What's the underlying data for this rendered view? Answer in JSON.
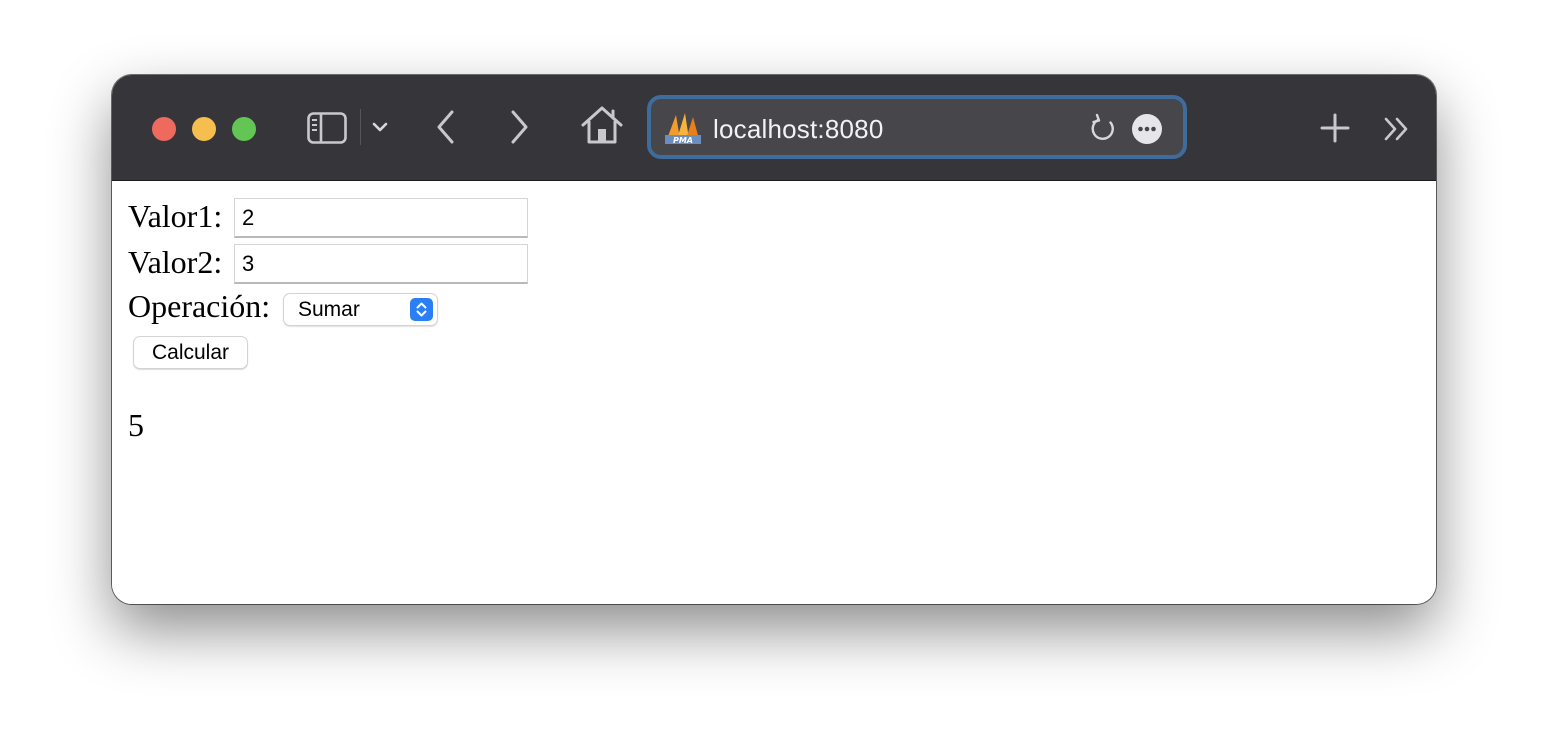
{
  "browser": {
    "address": "localhost:8080",
    "favicon_name": "phpmyadmin-logo",
    "colors": {
      "toolbar": "#363539",
      "close": "#ee6a5f",
      "minimize": "#f5be4f",
      "maximize": "#62c554",
      "url_focus_ring": "#3e6c9c"
    }
  },
  "form": {
    "valor1_label": "Valor1:",
    "valor1_value": "2",
    "valor2_label": "Valor2:",
    "valor2_value": "3",
    "operacion_label": "Operación:",
    "operacion_selected": "Sumar",
    "calcular_label": "Calcular"
  },
  "result": {
    "value": "5"
  }
}
